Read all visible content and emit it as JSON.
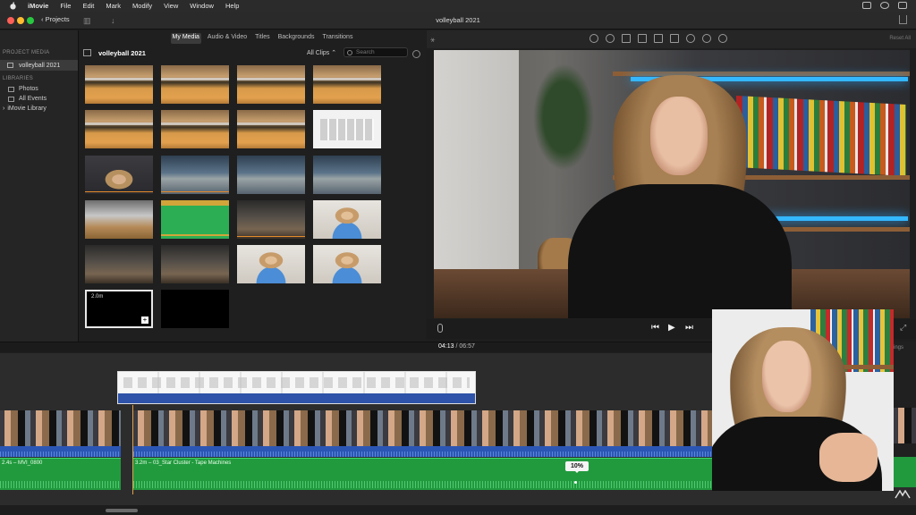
{
  "menubar": {
    "app": "iMovie",
    "items": [
      "File",
      "Edit",
      "Mark",
      "Modify",
      "View",
      "Window",
      "Help"
    ]
  },
  "window": {
    "projects_label": "Projects",
    "title": "volleyball 2021"
  },
  "sidebar": {
    "project_media_heading": "PROJECT MEDIA",
    "project_item": "volleyball 2021",
    "libraries_heading": "LIBRARIES",
    "library_items": [
      "Photos",
      "All Events",
      "iMovie Library"
    ]
  },
  "browser": {
    "tabs": [
      "My Media",
      "Audio & Video",
      "Titles",
      "Backgrounds",
      "Transitions"
    ],
    "active_tab": "My Media",
    "event_title": "volleyball 2021",
    "filter": "All Clips",
    "search_placeholder": "Search",
    "selected_clip_duration": "2.0m"
  },
  "viewer": {
    "reset_all": "Reset All",
    "current_time": "04:13",
    "total_time": "06:57"
  },
  "timeline": {
    "clip1_label": "2.4s – MVI_0800",
    "music_label": "3.2m – 03_Star Cluster - Tape Machines",
    "volume_percent": "10%",
    "partial_label": "ings"
  },
  "colors": {
    "accent_green": "#219a3e",
    "audio_blue": "#2c56b4",
    "playhead": "#e0a04a"
  }
}
